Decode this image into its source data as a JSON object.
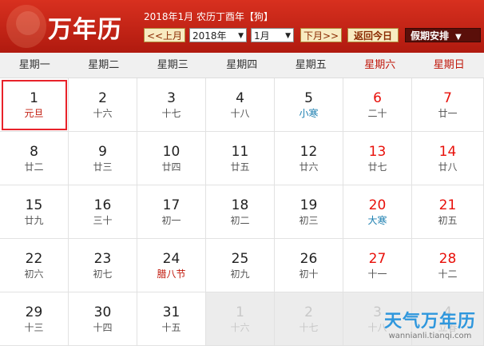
{
  "header": {
    "app_title": "万年历",
    "info_text": "2018年1月 农历丁酉年【",
    "zodiac": "狗",
    "info_tail": "】",
    "prev_label": "<<上月",
    "year_value": "2018年",
    "month_value": "1月",
    "next_label": "下月>>",
    "today_label": "返回今日",
    "holiday_label": "假期安排"
  },
  "weekdays": [
    "星期一",
    "星期二",
    "星期三",
    "星期四",
    "星期五",
    "星期六",
    "星期日"
  ],
  "weeks": [
    [
      {
        "d": "1",
        "l": "元旦"
      },
      {
        "d": "2",
        "l": "十六"
      },
      {
        "d": "3",
        "l": "十七"
      },
      {
        "d": "4",
        "l": "十八"
      },
      {
        "d": "5",
        "l": "小寒"
      },
      {
        "d": "6",
        "l": "二十"
      },
      {
        "d": "7",
        "l": "廿一"
      }
    ],
    [
      {
        "d": "8",
        "l": "廿二"
      },
      {
        "d": "9",
        "l": "廿三"
      },
      {
        "d": "10",
        "l": "廿四"
      },
      {
        "d": "11",
        "l": "廿五"
      },
      {
        "d": "12",
        "l": "廿六"
      },
      {
        "d": "13",
        "l": "廿七"
      },
      {
        "d": "14",
        "l": "廿八"
      }
    ],
    [
      {
        "d": "15",
        "l": "廿九"
      },
      {
        "d": "16",
        "l": "三十"
      },
      {
        "d": "17",
        "l": "初一"
      },
      {
        "d": "18",
        "l": "初二"
      },
      {
        "d": "19",
        "l": "初三"
      },
      {
        "d": "20",
        "l": "大寒"
      },
      {
        "d": "21",
        "l": "初五"
      }
    ],
    [
      {
        "d": "22",
        "l": "初六"
      },
      {
        "d": "23",
        "l": "初七"
      },
      {
        "d": "24",
        "l": "腊八节"
      },
      {
        "d": "25",
        "l": "初九"
      },
      {
        "d": "26",
        "l": "初十"
      },
      {
        "d": "27",
        "l": "十一"
      },
      {
        "d": "28",
        "l": "十二"
      }
    ],
    [
      {
        "d": "29",
        "l": "十三"
      },
      {
        "d": "30",
        "l": "十四"
      },
      {
        "d": "31",
        "l": "十五"
      },
      {
        "d": "1",
        "l": "十六"
      },
      {
        "d": "2",
        "l": "十七"
      },
      {
        "d": "3",
        "l": "十八"
      },
      {
        "d": "4",
        "l": "立春"
      }
    ]
  ],
  "watermark": {
    "title": "天气万年历",
    "url": "wannianli.tianqi.com"
  }
}
